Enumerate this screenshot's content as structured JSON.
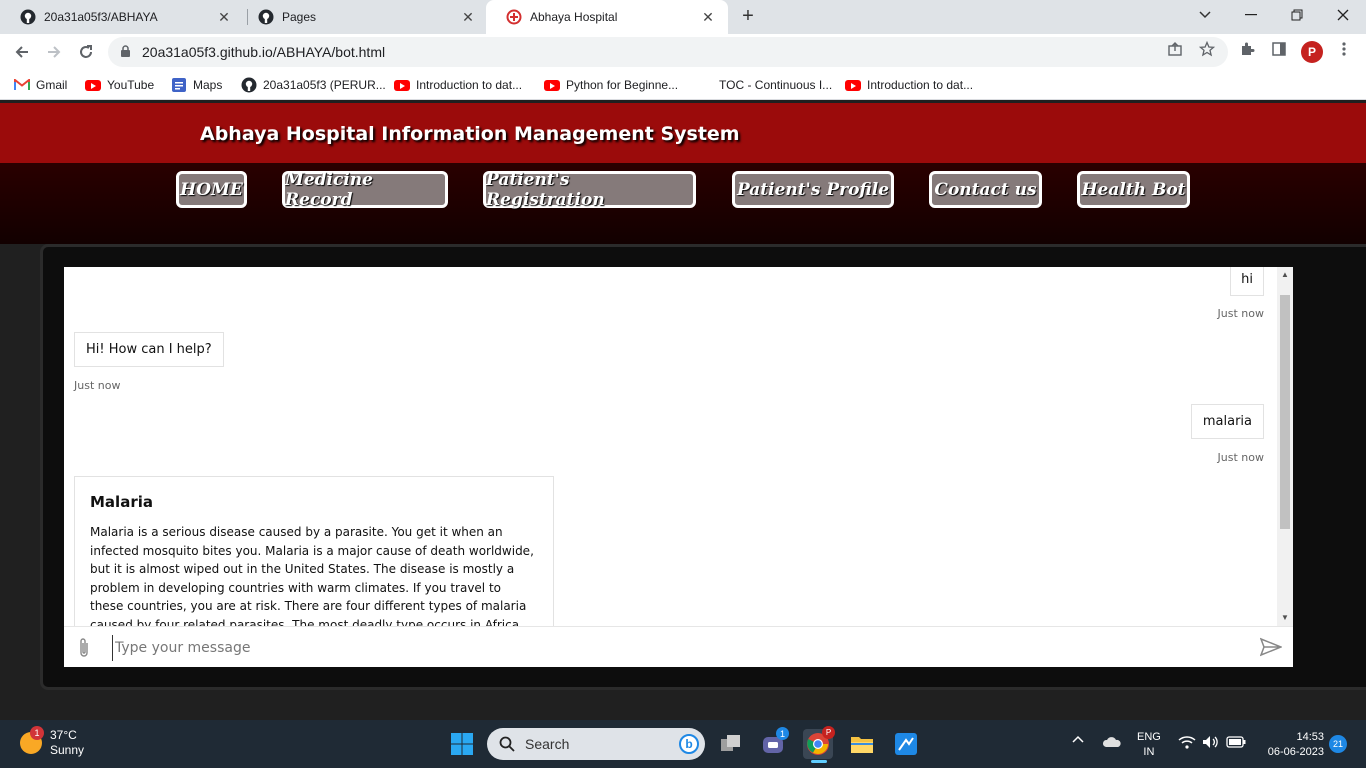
{
  "browser": {
    "tabs": [
      {
        "label": "20a31a05f3/ABHAYA",
        "icon": "github-icon"
      },
      {
        "label": "Pages",
        "icon": "github-icon"
      },
      {
        "label": "Abhaya Hospital",
        "icon": "hospital-icon",
        "active": true
      }
    ],
    "url": "20a31a05f3.github.io/ABHAYA/bot.html",
    "profile_initial": "P",
    "bookmarks": [
      {
        "label": "Gmail",
        "icon": "gmail-icon"
      },
      {
        "label": "YouTube",
        "icon": "youtube-icon"
      },
      {
        "label": "Maps",
        "icon": "maps-icon"
      },
      {
        "label": "20a31a05f3 (PERUR...",
        "icon": "github-icon"
      },
      {
        "label": "Introduction to dat...",
        "icon": "youtube-icon"
      },
      {
        "label": "Python for Beginne...",
        "icon": "youtube-icon"
      },
      {
        "label": "TOC - Continuous I...",
        "icon": "none"
      },
      {
        "label": "Introduction to dat...",
        "icon": "youtube-icon"
      }
    ]
  },
  "site": {
    "title": "Abhaya Hospital Information Management System",
    "nav": [
      "HOME",
      "Medicine Record",
      "Patient's Registration",
      "Patient's Profile",
      "Contact us",
      "Health Bot"
    ],
    "header_color": "#9b0b0b"
  },
  "chat": {
    "messages": [
      {
        "from": "user",
        "text": "hi",
        "time": "Just now"
      },
      {
        "from": "bot",
        "text": "Hi! How can I help?",
        "time": "Just now"
      },
      {
        "from": "user",
        "text": "malaria",
        "time": "Just now"
      },
      {
        "from": "bot",
        "title": "Malaria",
        "text": "Malaria is a serious disease caused by a parasite. You get it when an infected mosquito bites you. Malaria is a major cause of death worldwide, but it is almost wiped out in the United States. The disease is mostly a problem in developing countries with warm climates. If you travel to these countries, you are at risk. There are four different types of malaria caused by four related parasites. The most deadly type occurs in Africa south of the Sahara Desert."
      }
    ],
    "input_placeholder": "Type your message"
  },
  "taskbar": {
    "temperature": "37°C",
    "weather": "Sunny",
    "weather_badge": "1",
    "search_label": "Search",
    "teams_badge": "1",
    "language": "ENG",
    "region": "IN",
    "time": "14:53",
    "date": "06-06-2023",
    "notification_count": "21"
  }
}
